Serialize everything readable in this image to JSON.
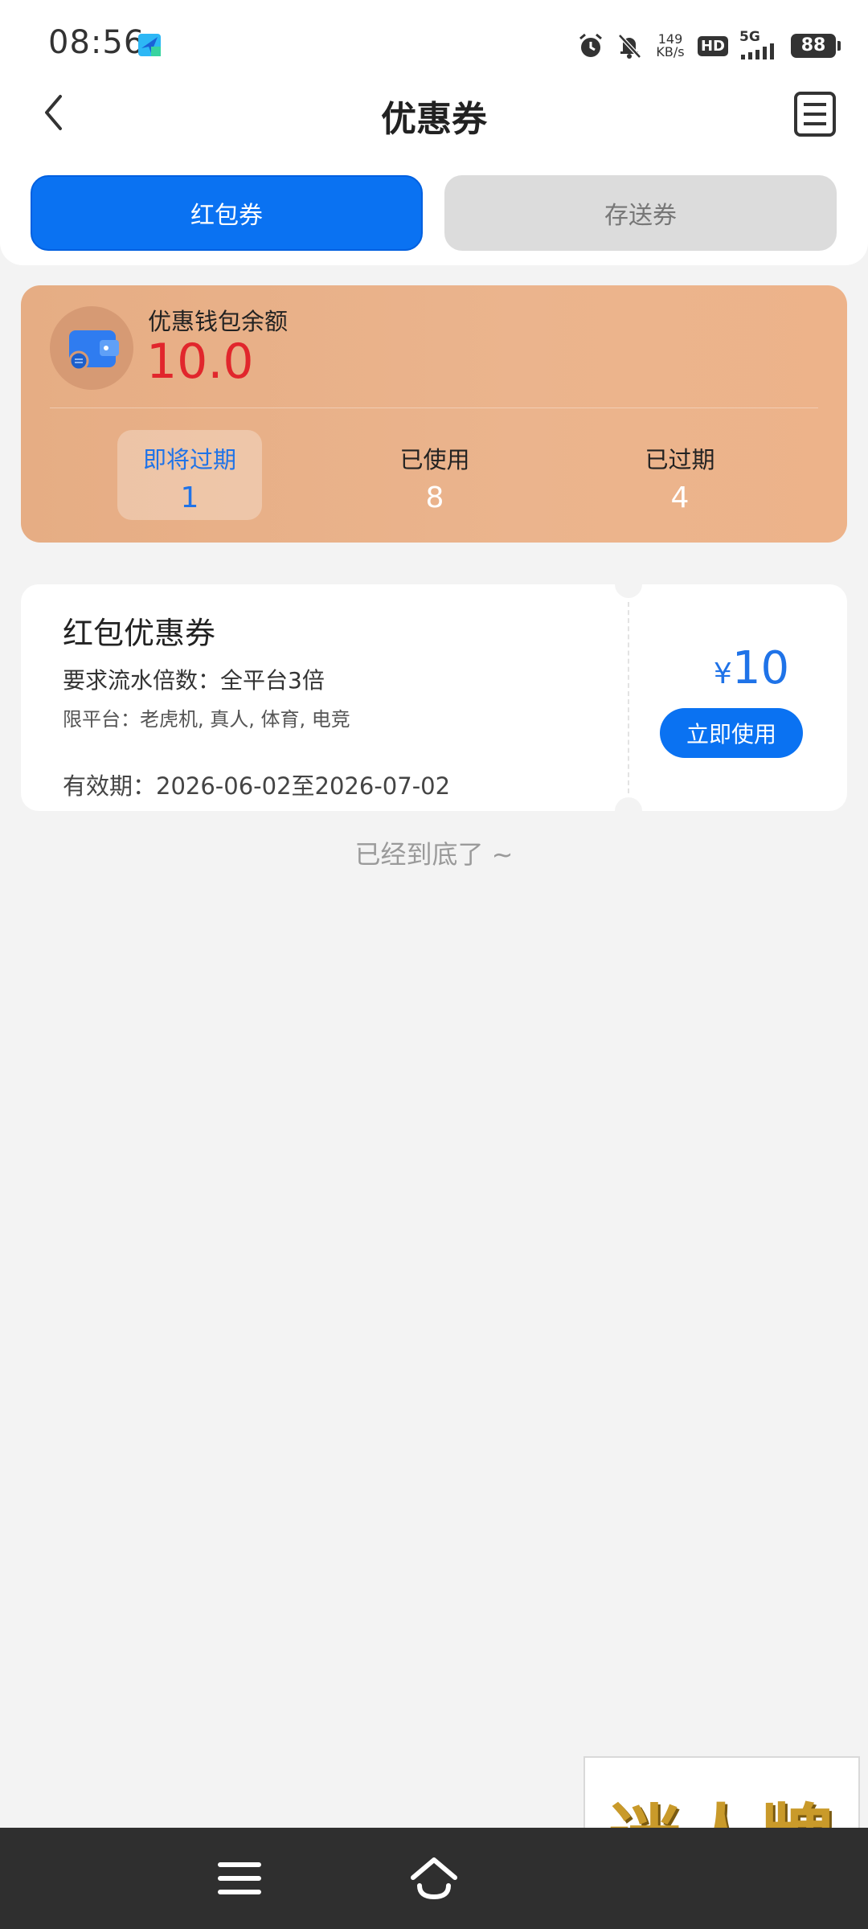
{
  "status_bar": {
    "time": "08:56",
    "net_speed_value": "149",
    "net_speed_unit": "KB/s",
    "hd_label": "HD",
    "network_label": "5G",
    "battery": "88"
  },
  "header": {
    "title": "优惠券",
    "tabs": [
      {
        "label": "红包券",
        "active": true
      },
      {
        "label": "存送券",
        "active": false
      }
    ]
  },
  "wallet": {
    "label": "优惠钱包余额",
    "amount": "10.0",
    "stats": [
      {
        "label": "即将过期",
        "value": "1",
        "selected": true
      },
      {
        "label": "已使用",
        "value": "8",
        "selected": false
      },
      {
        "label": "已过期",
        "value": "4",
        "selected": false
      }
    ]
  },
  "coupon": {
    "title": "红包优惠券",
    "requirement": "要求流水倍数：全平台3倍",
    "platforms": "限平台：老虎机, 真人, 体育, 电竞",
    "validity": "有效期：2026-06-02至2026-07-02",
    "currency": "¥",
    "amount": "10",
    "button_label": "立即使用"
  },
  "list_end_text": "已经到底了 ~",
  "watermark_text": "迷人牌",
  "colors": {
    "primary": "#0a72f2",
    "amount_red": "#e1262c",
    "wallet_bg": "#ebb48d",
    "page_bg": "#f3f3f3"
  }
}
